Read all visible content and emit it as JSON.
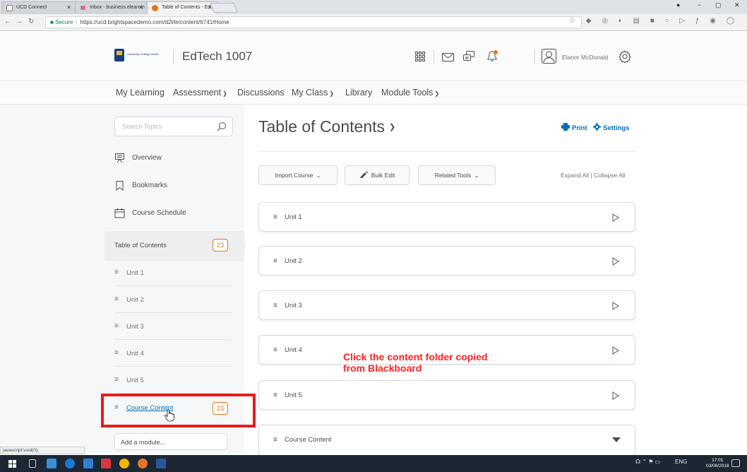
{
  "browser": {
    "tabs": [
      {
        "title": "UCD Connect",
        "active": false
      },
      {
        "title": "Inbox - business.elearnin",
        "active": false
      },
      {
        "title": "Table of Contents - EdTe",
        "active": true
      }
    ],
    "url_secure": "Secure",
    "url": "https://ucd.brightspacedemo.com/d2l/le/content/6741/Home"
  },
  "header": {
    "logo_text": "University College Dublin",
    "course_title": "EdTech 1007",
    "user_name": "Elanor McDonald"
  },
  "nav": {
    "items": [
      {
        "label": "My Learning",
        "dropdown": false
      },
      {
        "label": "Assessment",
        "dropdown": true
      },
      {
        "label": "Discussions",
        "dropdown": false
      },
      {
        "label": "My Class",
        "dropdown": true
      },
      {
        "label": "Library",
        "dropdown": false
      },
      {
        "label": "Module Tools",
        "dropdown": true
      }
    ]
  },
  "sidebar": {
    "search_placeholder": "Search Topics",
    "links": [
      "Overview",
      "Bookmarks",
      "Course Schedule"
    ],
    "toc_label": "Table of Contents",
    "toc_count": "23",
    "units": [
      "Unit 1",
      "Unit 2",
      "Unit 3",
      "Unit 4",
      "Unit 5"
    ],
    "course_content": "Course Content",
    "course_content_count": "23",
    "add_module": "Add a module..."
  },
  "main": {
    "title": "Table of Contents",
    "print": "Print",
    "settings": "Settings",
    "toolbar": {
      "import_course": "Import Course",
      "bulk_edit": "Bulk Edit",
      "related_tools": "Related Tools",
      "expand_all": "Expand All",
      "collapse_all": "Collapse All"
    },
    "units": [
      "Unit 1",
      "Unit 2",
      "Unit 3",
      "Unit 4",
      "Unit 5",
      "Course Content"
    ]
  },
  "annotation": {
    "line1": "Click the content folder copied",
    "line2": "from Blackboard"
  },
  "status_bar": "javascript:void(0);",
  "taskbar": {
    "language": "ENG",
    "time": "17:01",
    "date": "03/08/2018"
  },
  "colors": {
    "accent_blue": "#006fbf",
    "badge_orange": "#e87511",
    "highlight_red": "#e81c1c"
  }
}
